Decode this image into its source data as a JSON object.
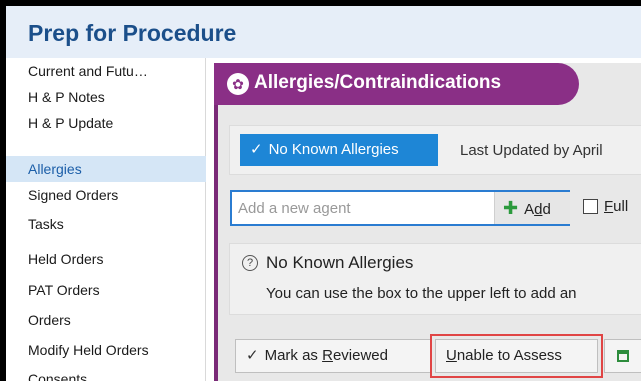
{
  "header": {
    "title": "Prep for Procedure"
  },
  "sidebar": {
    "items": [
      {
        "label": "Current and Futu…"
      },
      {
        "label": "H & P Notes"
      },
      {
        "label": "H & P Update"
      },
      {
        "label": "Allergies",
        "active": true
      },
      {
        "label": "Signed Orders"
      },
      {
        "label": "Tasks"
      },
      {
        "label": "Held Orders"
      },
      {
        "label": "PAT Orders"
      },
      {
        "label": "Orders"
      },
      {
        "label": "Modify Held Orders"
      },
      {
        "label": "Consents"
      }
    ]
  },
  "section": {
    "title": "Allergies/Contraindications",
    "icon": "allergy-icon"
  },
  "status": {
    "nka_button": "No Known Allergies",
    "last_updated": "Last Updated by April"
  },
  "agent": {
    "placeholder": "Add a new agent",
    "add_label_pre": "A",
    "add_label_under": "d",
    "add_label_post": "d",
    "full_label_under": "F",
    "full_label_post": "ull"
  },
  "info": {
    "title": "No Known Allergies",
    "text": "You can use the box to the upper left to add an"
  },
  "actions": {
    "reviewed_pre": "Mark as ",
    "reviewed_under": "R",
    "reviewed_post": "eviewed",
    "unable_under": "U",
    "unable_post": "nable to Assess"
  },
  "colors": {
    "header_bg": "#e6eef8",
    "title_blue": "#1b4f8a",
    "section_purple": "#8a2f86",
    "primary_blue": "#1e86d6",
    "highlight_red": "#e04545"
  }
}
